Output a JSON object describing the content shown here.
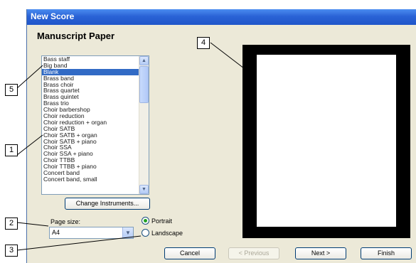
{
  "window": {
    "title": "New Score",
    "heading": "Manuscript Paper"
  },
  "list": {
    "items": [
      "Bass staff",
      "Big band",
      "Blank",
      "Brass band",
      "Brass choir",
      "Brass quartet",
      "Brass quintet",
      "Brass trio",
      "Choir barbershop",
      "Choir reduction",
      "Choir reduction + organ",
      "Choir SATB",
      "Choir SATB + organ",
      "Choir SATB + piano",
      "Choir SSA",
      "Choir SSA + piano",
      "Choir TTBB",
      "Choir TTBB + piano",
      "Concert band",
      "Concert band, small"
    ],
    "selected": "Blank"
  },
  "buttons": {
    "change_instruments": "Change Instruments...",
    "cancel": "Cancel",
    "previous": "< Previous",
    "next": "Next >",
    "finish": "Finish"
  },
  "page_size": {
    "label": "Page size:",
    "value": "A4"
  },
  "orientation": {
    "portrait": "Portrait",
    "landscape": "Landscape",
    "selected": "Portrait"
  },
  "callouts": {
    "c1": "1",
    "c2": "2",
    "c3": "3",
    "c4": "4",
    "c5": "5"
  },
  "icons": {
    "scroll_up": "scroll-up-arrow-icon",
    "scroll_down": "scroll-down-arrow-icon",
    "combo": "chevron-down-icon"
  }
}
